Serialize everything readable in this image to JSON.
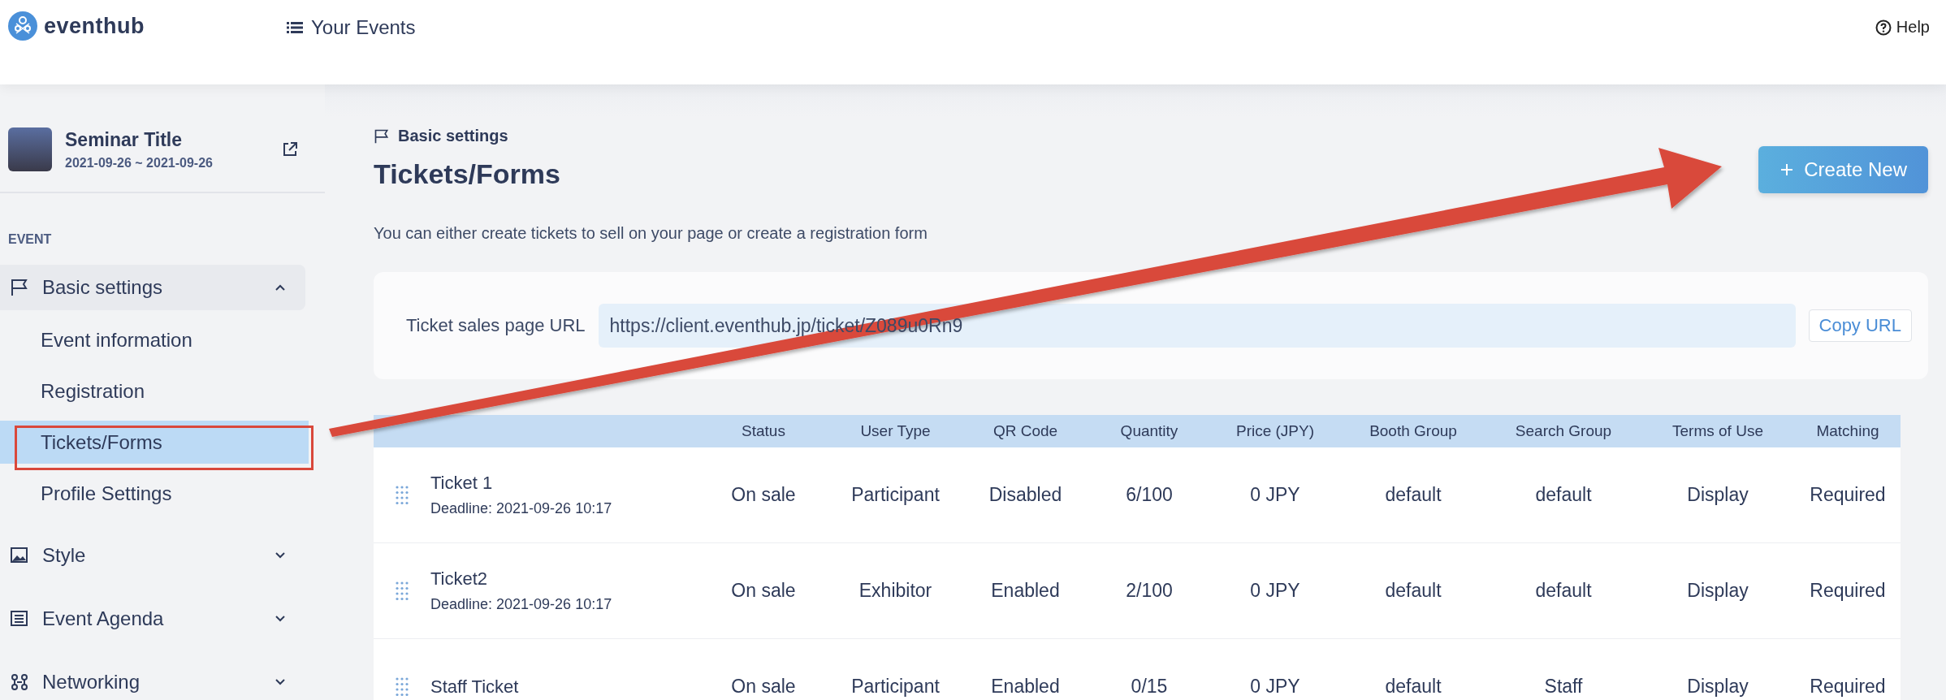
{
  "header": {
    "logo": "eventhub",
    "nav": "Your Events",
    "help": "Help"
  },
  "event": {
    "title": "Seminar Title",
    "dates": "2021-09-26 ~ 2021-09-26"
  },
  "sidebar": {
    "section_label": "EVENT",
    "items": [
      {
        "label": "Basic settings",
        "expanded": true,
        "children": [
          {
            "label": "Event information",
            "selected": false
          },
          {
            "label": "Registration",
            "selected": false
          },
          {
            "label": "Tickets/Forms",
            "selected": true
          },
          {
            "label": "Profile Settings",
            "selected": false
          }
        ]
      },
      {
        "label": "Style",
        "expanded": false
      },
      {
        "label": "Event Agenda",
        "expanded": false
      },
      {
        "label": "Networking",
        "expanded": false
      }
    ]
  },
  "page": {
    "breadcrumb": "Basic settings",
    "title": "Tickets/Forms",
    "description": "You can either create tickets to sell on your page or create a registration form",
    "create_button": "Create New"
  },
  "url_card": {
    "label": "Ticket sales page URL",
    "value": "https://client.eventhub.jp/ticket/Z089u0Rn9",
    "copy_button": "Copy URL"
  },
  "table": {
    "columns": [
      "Status",
      "User Type",
      "QR Code",
      "Quantity",
      "Price (JPY)",
      "Booth Group",
      "Search Group",
      "Terms of Use",
      "Matching"
    ],
    "rows": [
      {
        "name": "Ticket 1",
        "deadline": "Deadline: 2021-09-26 10:17",
        "cells": [
          "On sale",
          "Participant",
          "Disabled",
          "6/100",
          "0 JPY",
          "default",
          "default",
          "Display",
          "Required"
        ]
      },
      {
        "name": "Ticket2",
        "deadline": "Deadline: 2021-09-26 10:17",
        "cells": [
          "On sale",
          "Exhibitor",
          "Enabled",
          "2/100",
          "0 JPY",
          "default",
          "default",
          "Display",
          "Required"
        ]
      },
      {
        "name": "Staff Ticket",
        "cells": [
          "On sale",
          "Participant",
          "Enabled",
          "0/15",
          "0 JPY",
          "default",
          "Staff",
          "Display",
          "Required"
        ]
      }
    ]
  }
}
